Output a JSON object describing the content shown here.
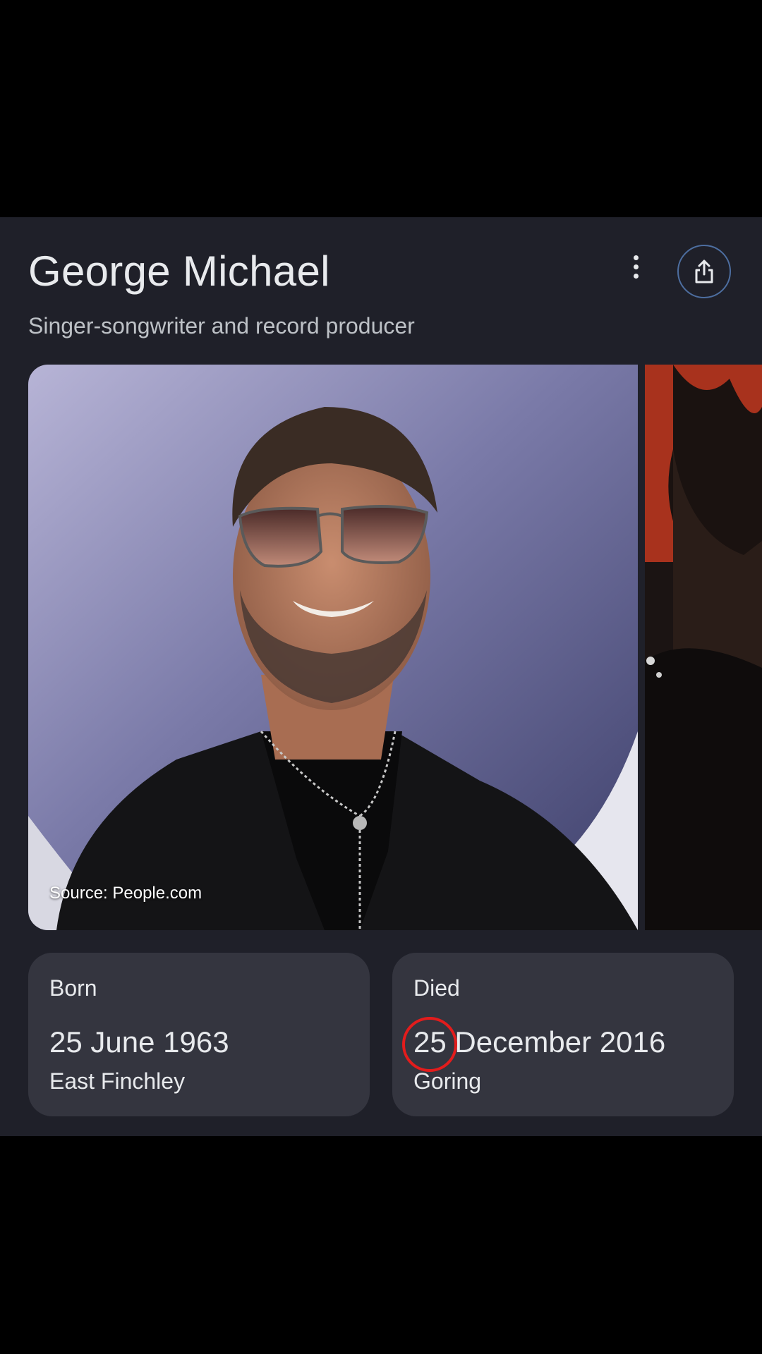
{
  "knowledge_panel": {
    "title": "George Michael",
    "subtitle": "Singer-songwriter and record producer",
    "more_icon": "more-vert-icon",
    "share_icon": "share-icon",
    "image_source": "Source: People.com"
  },
  "facts": {
    "born": {
      "label": "Born",
      "date": "25 June 1963",
      "place": "East Finchley"
    },
    "died": {
      "label": "Died",
      "date": "25 December 2016",
      "place": "Goring"
    }
  },
  "colors": {
    "panel_bg": "#1f2029",
    "card_bg": "#34353f",
    "text_primary": "#e8eaed",
    "text_secondary": "#bdc1c6",
    "share_border": "#4d6ea0",
    "annotation": "#e31c1c"
  }
}
